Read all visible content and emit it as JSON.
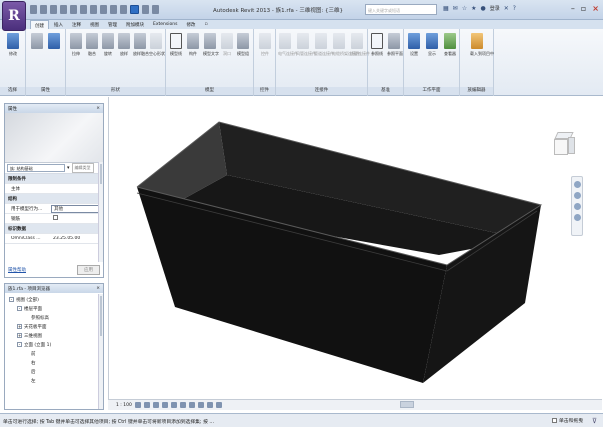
{
  "app": {
    "logo": "R",
    "title": "Autodesk Revit 2013 -    族1.rfa - 三维视图: {三维}",
    "search_placeholder": "键入关键字或短语",
    "login": "登录",
    "help": "?"
  },
  "tabs": [
    "创建",
    "插入",
    "注释",
    "视图",
    "管理",
    "附加模块",
    "Extensions",
    "修改",
    "▫"
  ],
  "ribbon": {
    "panels": [
      {
        "label": "选择",
        "buttons": [
          "修改"
        ]
      },
      {
        "label": "属性",
        "buttons": [
          "",
          ""
        ]
      },
      {
        "label": "形状",
        "buttons": [
          "拉伸",
          "融合",
          "旋转",
          "放样",
          "放样融合",
          "空心形状"
        ]
      },
      {
        "label": "模型",
        "buttons": [
          "模型线",
          "构件",
          "模型文字",
          "洞口",
          "模型组"
        ]
      },
      {
        "label": "控件",
        "buttons": [
          "控件"
        ]
      },
      {
        "label": "连接件",
        "buttons": [
          "电气连接件",
          "风管连接件",
          "管道连接件",
          "电缆桥架连接件",
          "线管连接件"
        ]
      },
      {
        "label": "基准",
        "buttons": [
          "参照线",
          "参照平面"
        ]
      },
      {
        "label": "工作平面",
        "buttons": [
          "设置",
          "显示",
          "查看器"
        ]
      },
      {
        "label": "族编辑器",
        "buttons": [
          "载入到项目中"
        ]
      }
    ]
  },
  "properties": {
    "title": "属性",
    "close": "×",
    "type_selector": "族: 结构基础",
    "edit_type": "编辑类型",
    "rows": [
      {
        "group": "限制条件"
      },
      {
        "key": "主体",
        "value": ""
      },
      {
        "group": "结构"
      },
      {
        "key": "用于模型行为...",
        "value": "其他",
        "editing": true
      },
      {
        "key": "钢筋",
        "value": "",
        "checkbox": true
      },
      {
        "group": "标识数据"
      },
      {
        "key": "OmniClass ...",
        "value": "23.25.05.00"
      }
    ],
    "help_link": "属性帮助",
    "apply": "应用"
  },
  "browser": {
    "title": "族1.rfa - 项目浏览器",
    "close": "×",
    "tree": [
      {
        "level": 0,
        "toggle": "-",
        "label": "视图 (全部)"
      },
      {
        "level": 1,
        "toggle": "-",
        "label": "楼层平面"
      },
      {
        "level": 2,
        "toggle": "",
        "label": "参照标高"
      },
      {
        "level": 1,
        "toggle": "+",
        "label": "天花板平面"
      },
      {
        "level": 1,
        "toggle": "+",
        "label": "三维视图"
      },
      {
        "level": 1,
        "toggle": "-",
        "label": "立面 (立面 1)"
      },
      {
        "level": 2,
        "toggle": "",
        "label": "前"
      },
      {
        "level": 2,
        "toggle": "",
        "label": "右"
      },
      {
        "level": 2,
        "toggle": "",
        "label": "后"
      },
      {
        "level": 2,
        "toggle": "",
        "label": "左"
      }
    ]
  },
  "viewbar": {
    "scale": "1 : 100"
  },
  "status": {
    "message": "单击可进行选择; 按 Tab 键并单击可选择其他项目; 按 Ctrl 键并单击可将新项目添加到选择集; 按 ...",
    "editable_only": "单击和拖曳"
  },
  "colors": {
    "model": "#111111",
    "ribbon_tab": "#d5e1ef",
    "accent": "#2f6fc4"
  }
}
